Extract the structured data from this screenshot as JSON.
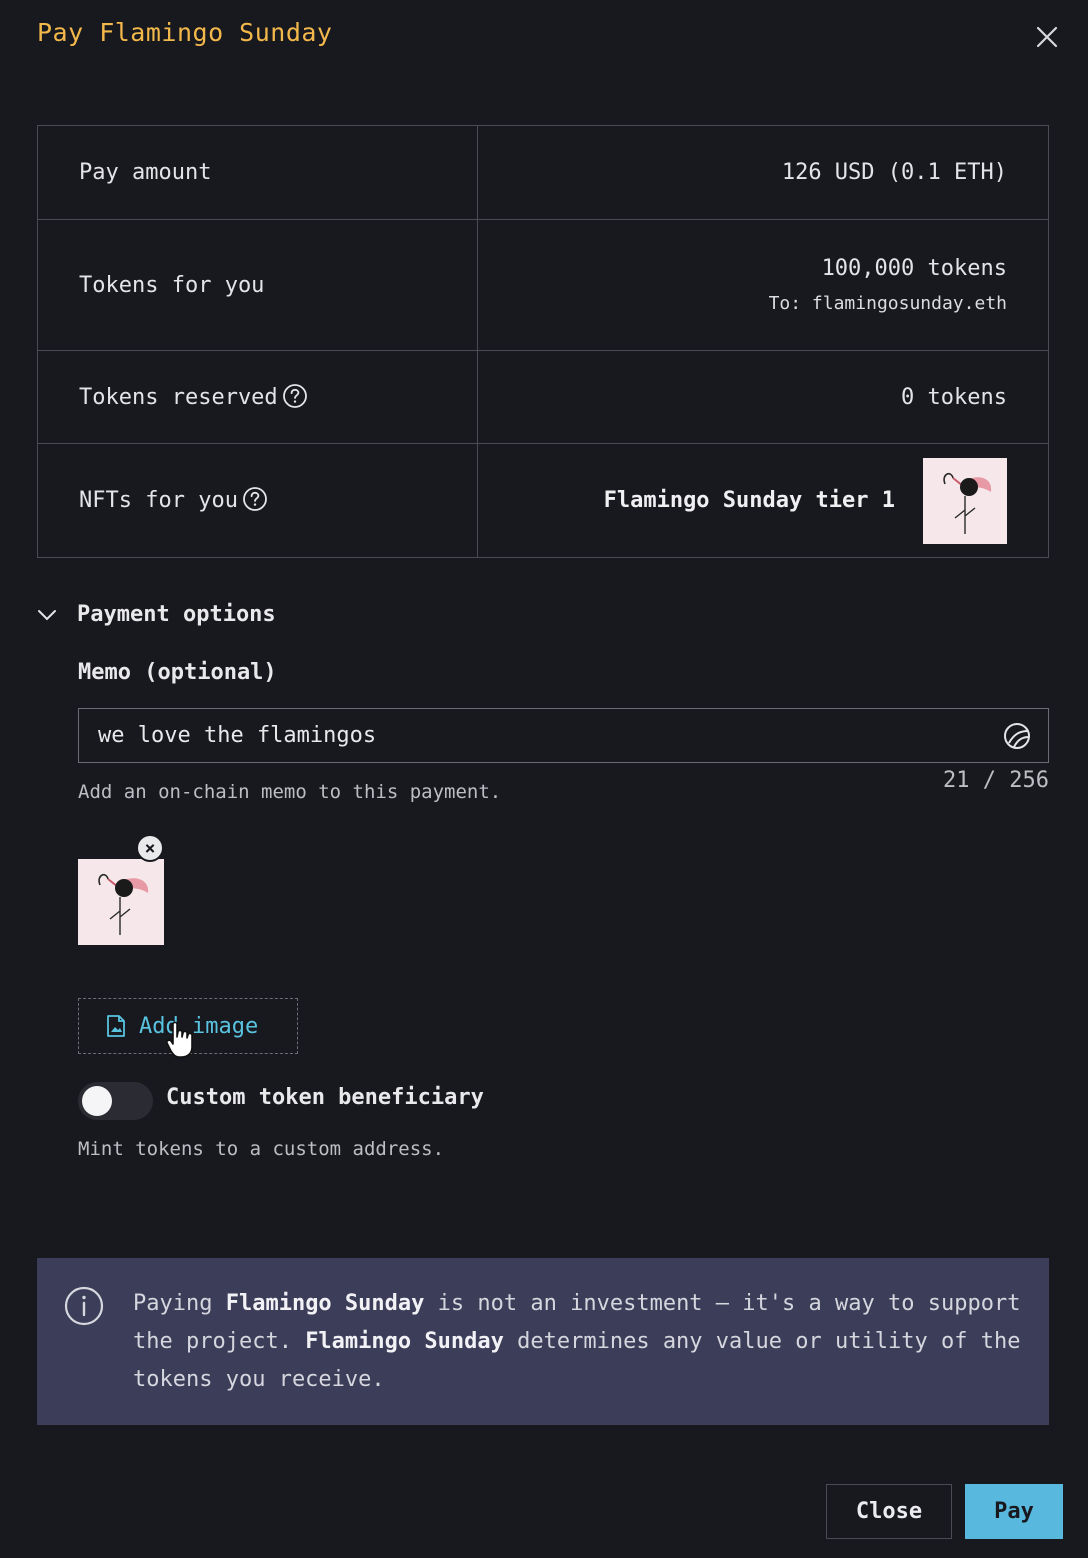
{
  "modal": {
    "title": "Pay Flamingo Sunday"
  },
  "summary": {
    "pay_amount_label": "Pay amount",
    "pay_amount_value": "126 USD (0.1 ETH)",
    "tokens_for_you_label": "Tokens for you",
    "tokens_for_you_value": "100,000 tokens",
    "tokens_for_you_recipient": "To: flamingosunday.eth",
    "tokens_reserved_label": "Tokens reserved",
    "tokens_reserved_value": "0 tokens",
    "nfts_label": "NFTs for you",
    "nft_name": "Flamingo Sunday tier 1"
  },
  "payment_options": {
    "header": "Payment options",
    "memo_label": "Memo (optional)",
    "memo_value": "we love the flamingos",
    "memo_counter": "21 / 256",
    "memo_help": "Add an on-chain memo to this payment.",
    "add_image_label": "Add image",
    "beneficiary_label": "Custom token beneficiary",
    "beneficiary_enabled": false,
    "beneficiary_help": "Mint tokens to a custom address."
  },
  "notice": {
    "part1": "Paying ",
    "project1": "Flamingo Sunday",
    "part2": " is not an investment — it's a way to support the project. ",
    "project2": "Flamingo Sunday",
    "part3": " determines any value or utility of the tokens you receive."
  },
  "footer": {
    "close_label": "Close",
    "pay_label": "Pay"
  },
  "colors": {
    "accent_title": "#f3b84b",
    "link": "#59c3e0",
    "pay_button": "#58b8de",
    "notice_bg": "#3c3d58",
    "background": "#18191e"
  },
  "icons": [
    "close-icon",
    "help-icon",
    "chevron-down-icon",
    "sticker-icon",
    "file-image-icon",
    "info-icon",
    "remove-icon",
    "pointer-cursor-icon"
  ]
}
